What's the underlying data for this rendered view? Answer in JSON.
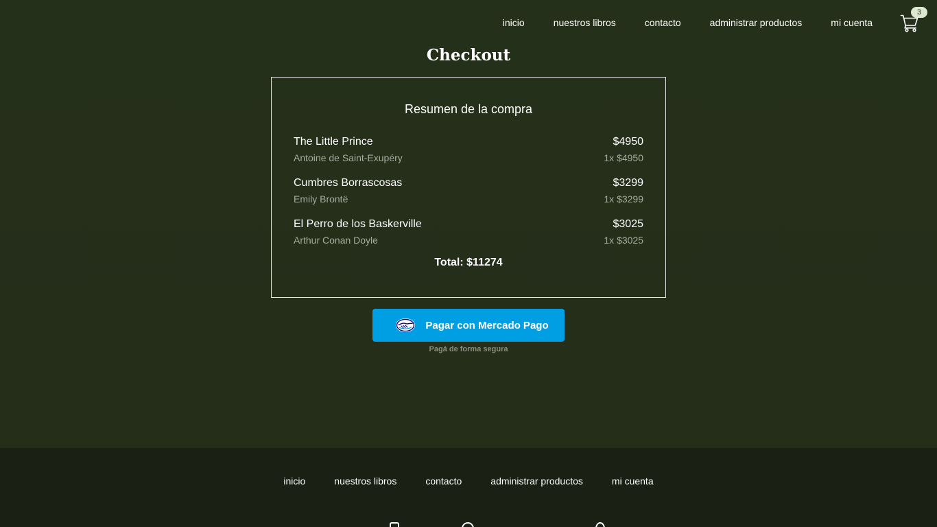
{
  "nav": {
    "items": [
      {
        "label": "inicio"
      },
      {
        "label": "nuestros libros"
      },
      {
        "label": "contacto"
      },
      {
        "label": "administrar productos"
      },
      {
        "label": "mi cuenta"
      }
    ],
    "cart": {
      "icon": "cart-icon",
      "count": "3"
    }
  },
  "page": {
    "title": "Checkout"
  },
  "summary": {
    "heading": "Resumen de la compra",
    "items": [
      {
        "title": "The Little Prince",
        "author": "Antoine de Saint-Exupéry",
        "price": "$4950",
        "qty": "1x $4950"
      },
      {
        "title": "Cumbres Borrascosas",
        "author": "Emily Brontë",
        "price": "$3299",
        "qty": "1x $3299"
      },
      {
        "title": "El Perro de los Baskerville",
        "author": "Arthur Conan Doyle",
        "price": "$3025",
        "qty": "1x $3025"
      }
    ],
    "total": "Total: $11274"
  },
  "payment": {
    "button_label": "Pagar con Mercado Pago",
    "icon": "mercado-pago-handshake-icon",
    "secure_text": "Pagá de forma segura",
    "colors": {
      "button": "#009ee3"
    }
  },
  "footer": {
    "items": [
      {
        "label": "inicio"
      },
      {
        "label": "nuestros libros"
      },
      {
        "label": "contacto"
      },
      {
        "label": "administrar productos"
      },
      {
        "label": "mi cuenta"
      }
    ],
    "social_icons": [
      "social-icon",
      "social-icon",
      "social-icon"
    ]
  },
  "colors": {
    "background": "#262e1a",
    "footer": "#1a2014",
    "badge": "#dce9d0"
  }
}
